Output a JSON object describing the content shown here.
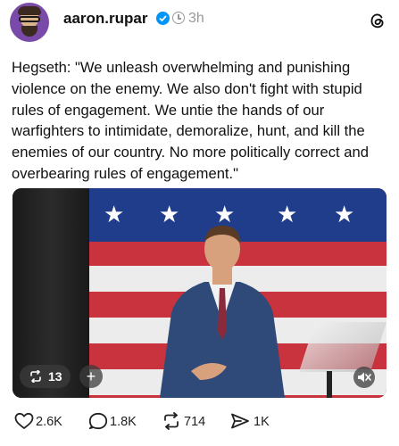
{
  "post": {
    "username": "aaron.rupar",
    "time": "3h",
    "text": "Hegseth: \"We unleash overwhelming and punishing violence on the enemy. We also don't fight with stupid rules of engagement. We untie the hands of our warfighters to intimidate, demoralize, hunt, and kill the enemies of our country. No more politically correct and overbearing rules of engagement.\""
  },
  "video": {
    "repost_count": "13",
    "plus_label": "+"
  },
  "actions": {
    "likes": "2.6K",
    "replies": "1.8K",
    "reposts": "714",
    "shares": "1K"
  },
  "icons": [
    "verified-icon",
    "clock-icon",
    "threads-logo-icon",
    "repost-icon",
    "mute-icon",
    "heart-icon",
    "comment-icon",
    "share-icon"
  ],
  "colors": {
    "verified": "#0095f6",
    "muted_text": "#999999"
  }
}
